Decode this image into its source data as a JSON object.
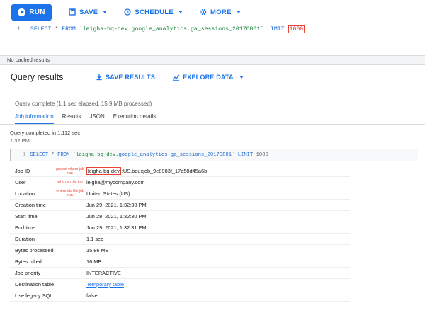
{
  "toolbar": {
    "run_label": "RUN",
    "save_label": "SAVE",
    "schedule_label": "SCHEDULE",
    "more_label": "MORE"
  },
  "editor": {
    "line_number": "1",
    "select_kw": "SELECT",
    "star": " * ",
    "from_kw": "FROM",
    "table": " `leigha-bq-dev.google_analytics.ga_sessions_20170801` ",
    "limit_kw": "LIMIT",
    "limit_value": "1000"
  },
  "cached_text": "No cached results",
  "results": {
    "title": "Query results",
    "save_results": "SAVE RESULTS",
    "explore_data": "EXPLORE DATA"
  },
  "complete_text": "Query complete (1.1 sec elapsed, 15.9 MB processed)",
  "tabs": [
    "Job information",
    "Results",
    "JSON",
    "Execution details"
  ],
  "completed_in": "Query completed in 1.112 sec",
  "completed_time": "1:32 PM",
  "query_box": {
    "line_number": "1",
    "select_kw": "SELECT",
    "star": " * ",
    "from_kw": "FROM",
    "table_prefix": " `leigha-bq-dev.",
    "table_dataset": "google_analytics.ga_sessions_20170801",
    "table_suffix": "` ",
    "limit_kw": "LIMIT",
    "limit_value": " 1000"
  },
  "annotations": {
    "job_id_note": "project where job ran",
    "user_note": "who ran the job",
    "location_note": "where did the job run"
  },
  "details": {
    "job_id_label": "Job ID",
    "job_id_project": "leigha-bq-dev",
    "job_id_rest": ":US.bquxjob_9e8983f_17a58d45a6b",
    "user_label": "User",
    "user_value": "leigha@mycompany.com",
    "location_label": "Location",
    "location_value": "United States (US)",
    "creation_label": "Creation time",
    "creation_value": "Jun 29, 2021, 1:32:30 PM",
    "start_label": "Start time",
    "start_value": "Jun 29, 2021, 1:32:30 PM",
    "end_label": "End time",
    "end_value": "Jun 29, 2021, 1:32:31 PM",
    "duration_label": "Duration",
    "duration_value": "1.1 sec",
    "bytes_processed_label": "Bytes processed",
    "bytes_processed_value": "15.86 MB",
    "bytes_billed_label": "Bytes billed",
    "bytes_billed_value": "16 MB",
    "priority_label": "Job priority",
    "priority_value": "INTERACTIVE",
    "destination_label": "Destination table",
    "destination_value": "Temporary table",
    "legacy_label": "Use legacy SQL",
    "legacy_value": "false"
  },
  "colors": {
    "primary": "#1a73e8",
    "annotation": "#ea4335"
  }
}
